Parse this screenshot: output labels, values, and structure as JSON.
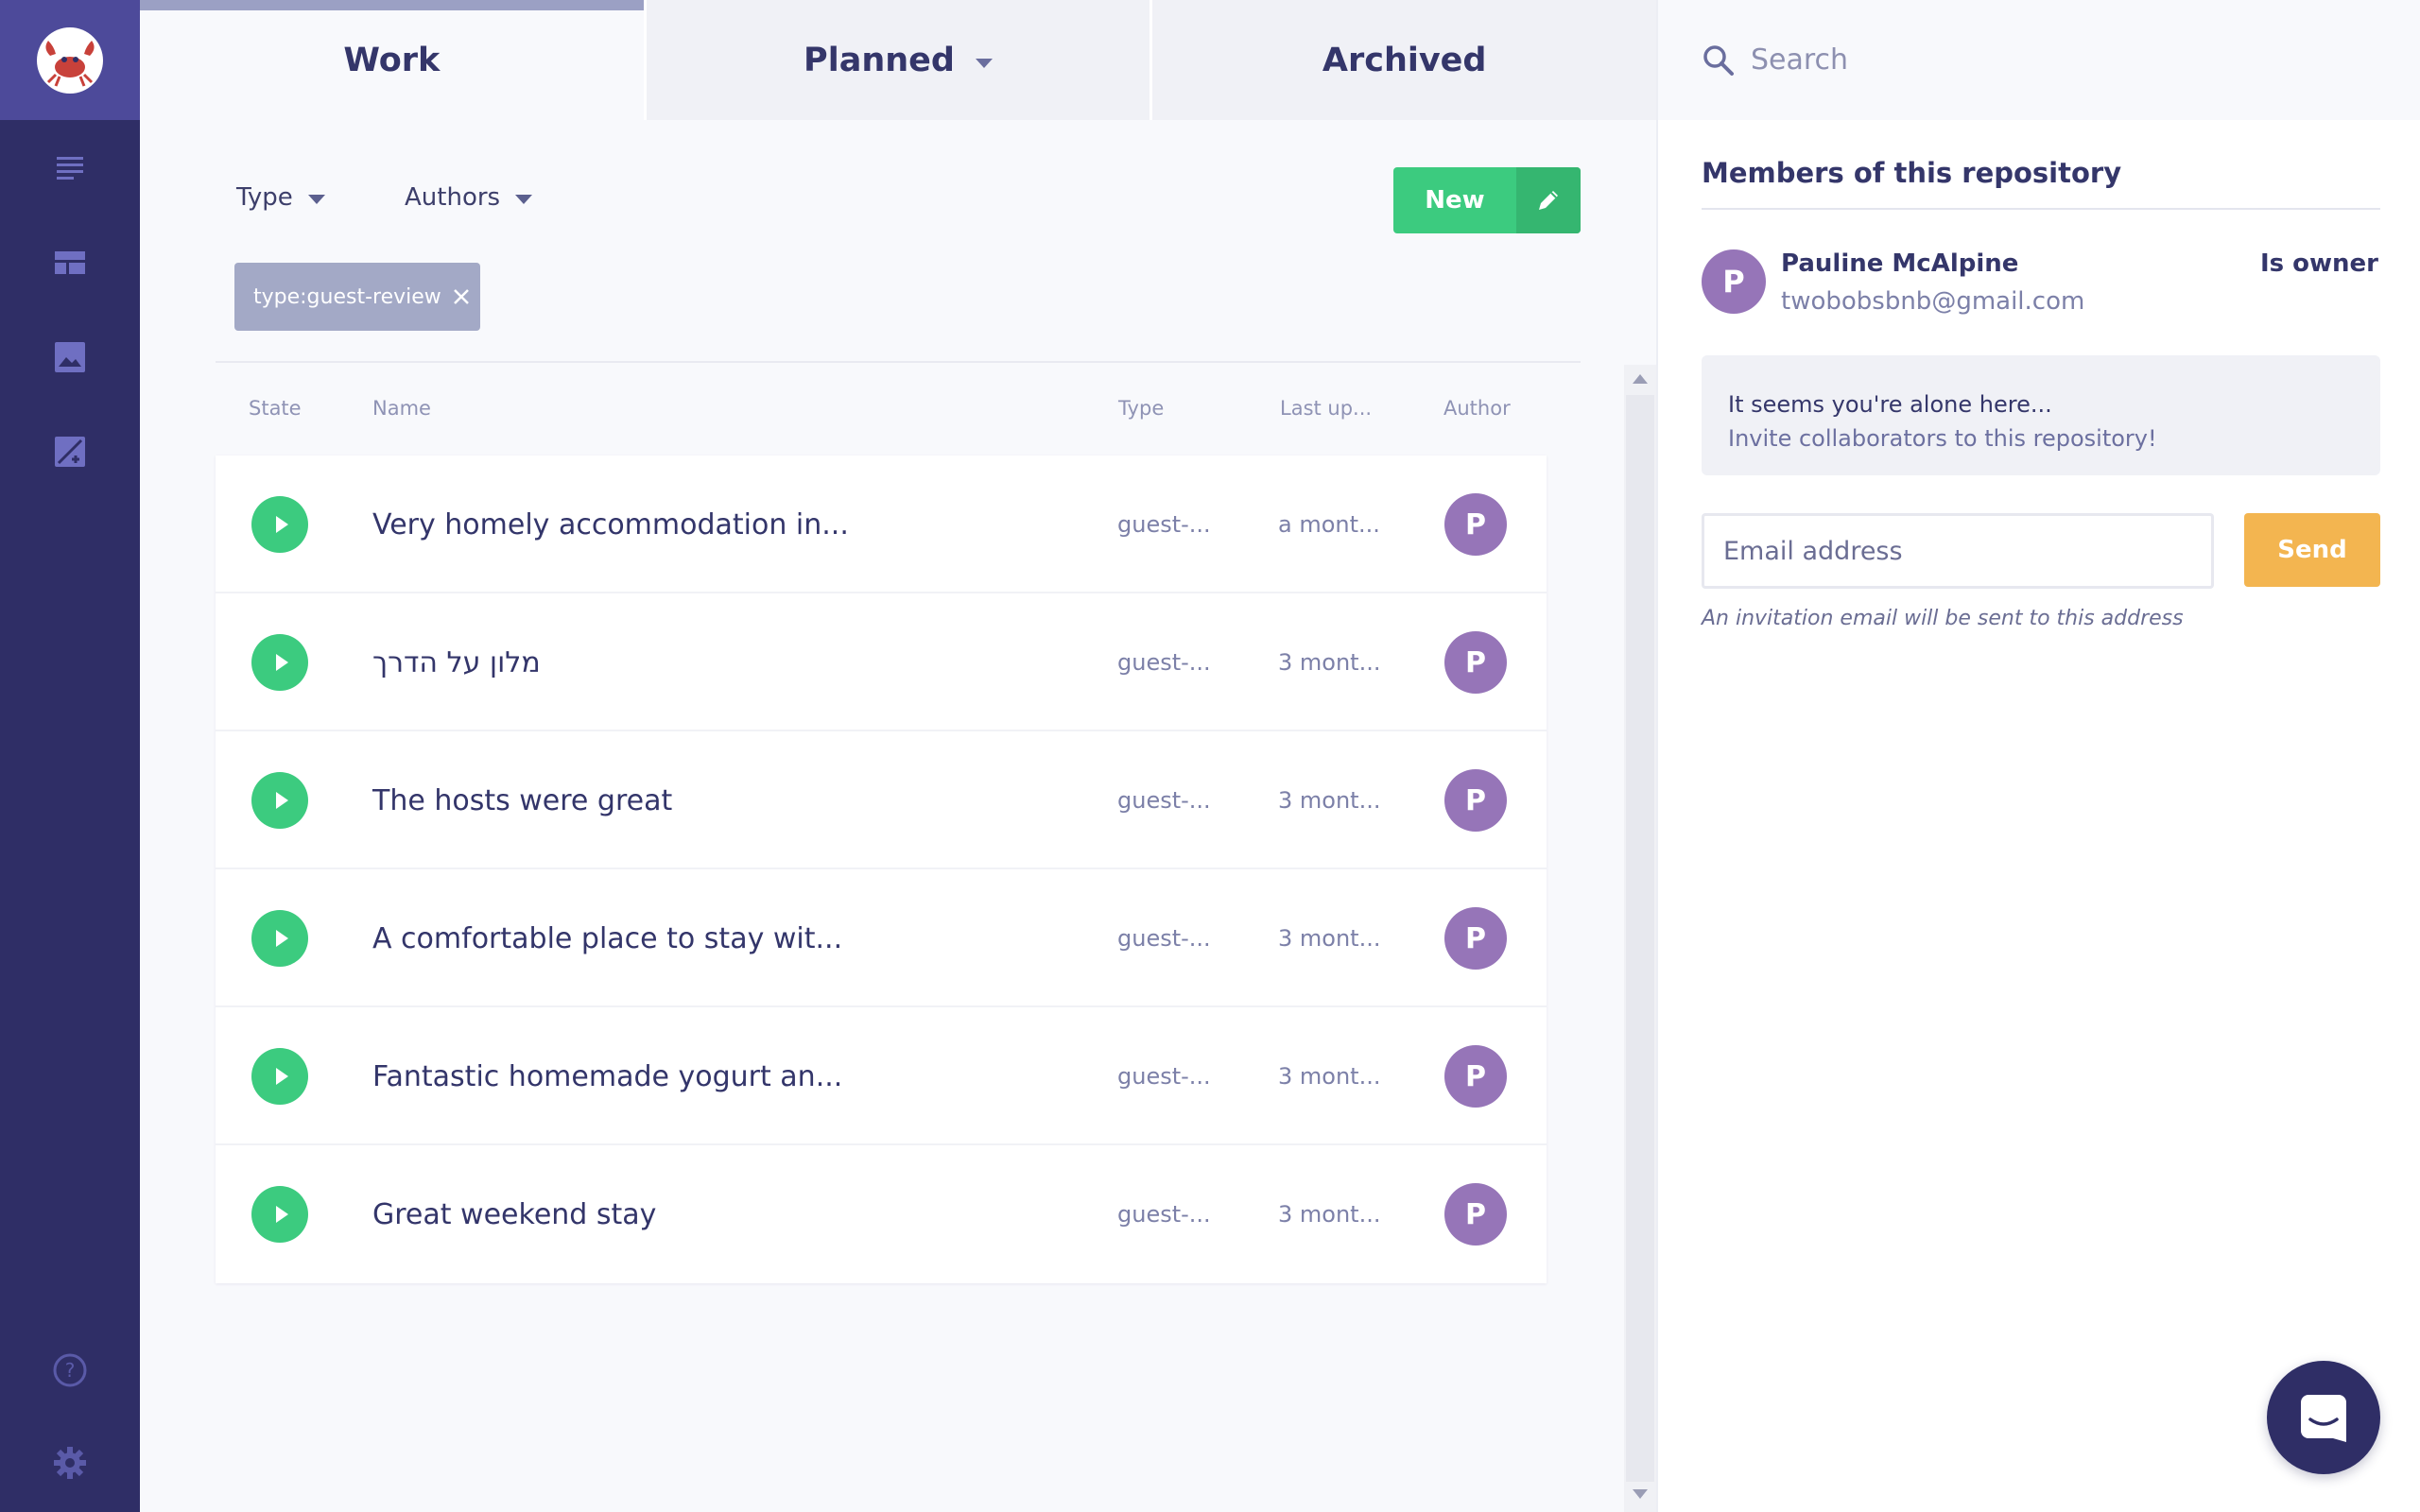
{
  "tabs": [
    {
      "label": "Work",
      "active": true
    },
    {
      "label": "Planned",
      "active": false
    },
    {
      "label": "Archived",
      "active": false
    }
  ],
  "nav": {
    "logo": "crab-logo-icon",
    "items": [
      "documents-list-icon",
      "layout-icon",
      "image-icon",
      "edit-image-icon"
    ],
    "bottom": [
      "help-icon",
      "settings-icon"
    ]
  },
  "filters": {
    "type_label": "Type",
    "authors_label": "Authors"
  },
  "toolbar": {
    "new_label": "New"
  },
  "active_filter_chip": "type:guest-review",
  "table": {
    "headers": {
      "state": "State",
      "name": "Name",
      "type": "Type",
      "updated": "Last up...",
      "author": "Author"
    },
    "rows": [
      {
        "name": "Very homely accommodation in...",
        "type": "guest-...",
        "updated": "a mont...",
        "author": "P"
      },
      {
        "name": "מלון על הדרך",
        "type": "guest-...",
        "updated": "3 mont...",
        "author": "P"
      },
      {
        "name": "The hosts were great",
        "type": "guest-...",
        "updated": "3 mont...",
        "author": "P"
      },
      {
        "name": "A comfortable place to stay wit...",
        "type": "guest-...",
        "updated": "3 mont...",
        "author": "P"
      },
      {
        "name": "Fantastic homemade yogurt an...",
        "type": "guest-...",
        "updated": "3 mont...",
        "author": "P"
      },
      {
        "name": "Great weekend stay",
        "type": "guest-...",
        "updated": "3 mont...",
        "author": "P"
      }
    ]
  },
  "search": {
    "placeholder": "Search"
  },
  "members": {
    "title": "Members of this repository",
    "list": [
      {
        "initial": "P",
        "name": "Pauline McAlpine",
        "email": "twobobsbnb@gmail.com",
        "role": "Is owner"
      }
    ],
    "alone_line1": "It seems you're alone here...",
    "alone_line2": "Invite collaborators to this repository!",
    "email_placeholder": "Email address",
    "send_label": "Send",
    "invite_note": "An invitation email will be sent to this address"
  },
  "colors": {
    "nav_bg": "#2f2e66",
    "accent_green": "#3ccb7f",
    "send_orange": "#f3b550",
    "avatar_purple": "#9675b8"
  }
}
